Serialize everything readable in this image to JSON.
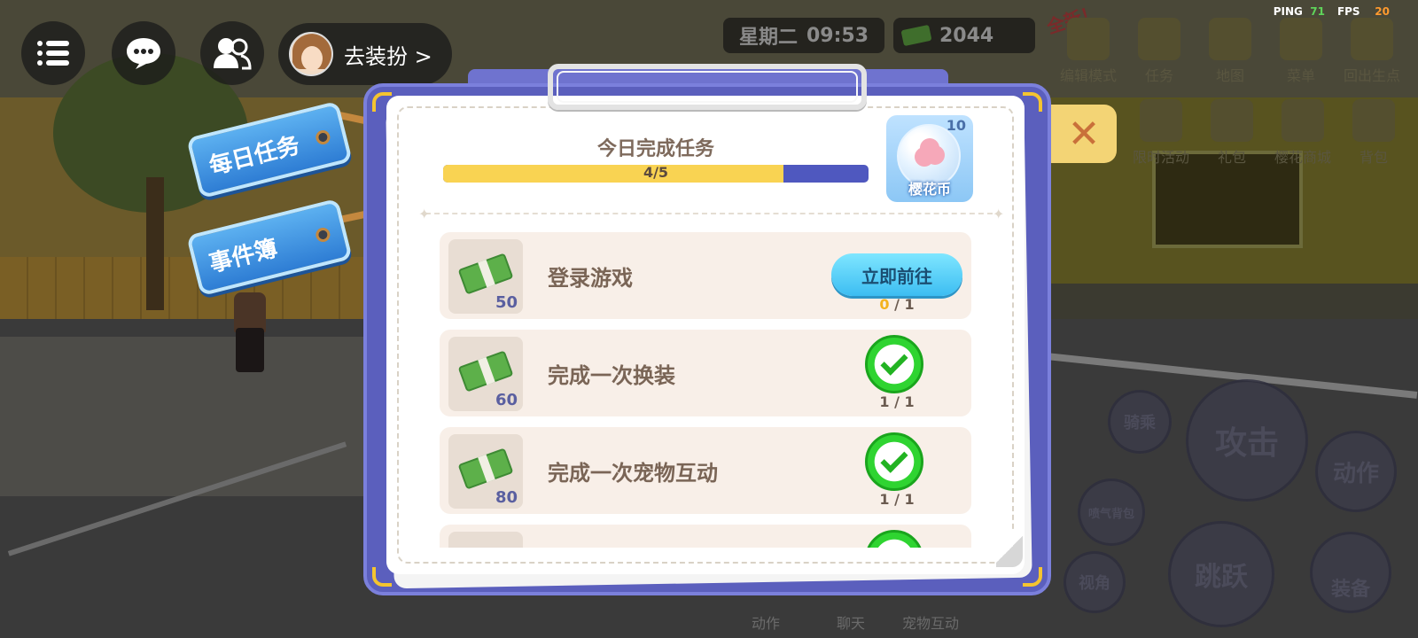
{
  "hud": {
    "dress_label": "去装扮 >",
    "day": "星期二",
    "time": "09:53",
    "money": "2044",
    "ping_label": "PING",
    "ping_value": "71",
    "fps_label": "FPS",
    "fps_value": "20"
  },
  "top_menu": {
    "new_tag": "全新！",
    "items": [
      {
        "label": "编辑模式",
        "icon": "edit-mode-icon"
      },
      {
        "label": "任务",
        "icon": "task-icon"
      },
      {
        "label": "地图",
        "icon": "map-icon"
      },
      {
        "label": "菜单",
        "icon": "menu-scroll-icon"
      },
      {
        "label": "回出生点",
        "icon": "spawn-pin-icon"
      },
      {
        "label": "限时活动",
        "icon": "crown-icon"
      },
      {
        "label": "礼包",
        "icon": "gift-icon"
      },
      {
        "label": "樱花商城",
        "icon": "shop-icon"
      },
      {
        "label": "背包",
        "icon": "backpack-icon"
      }
    ]
  },
  "side_tags": {
    "daily": "每日任务",
    "events": "事件簿"
  },
  "actions": {
    "ride": "骑乘",
    "attack": "攻击",
    "emote": "动作",
    "spray": "喷气背包",
    "jump": "跳跃",
    "view": "视角",
    "equip": "装备",
    "bottom_emote": "动作",
    "bottom_chat": "聊天",
    "bottom_pet": "宠物互动"
  },
  "dialog": {
    "progress_title": "今日完成任务",
    "progress_text": "4/5",
    "progress_fraction": 0.8,
    "reward": {
      "count": "10",
      "label": "樱花币"
    },
    "tasks": [
      {
        "title": "登录游戏",
        "reward": "50",
        "progress_done": "0",
        "progress_total": "/ 1",
        "action": "立即前往",
        "completed": false
      },
      {
        "title": "完成一次换装",
        "reward": "60",
        "progress": "1 / 1",
        "completed": true
      },
      {
        "title": "完成一次宠物互动",
        "reward": "80",
        "progress": "1 / 1",
        "completed": true
      }
    ]
  }
}
